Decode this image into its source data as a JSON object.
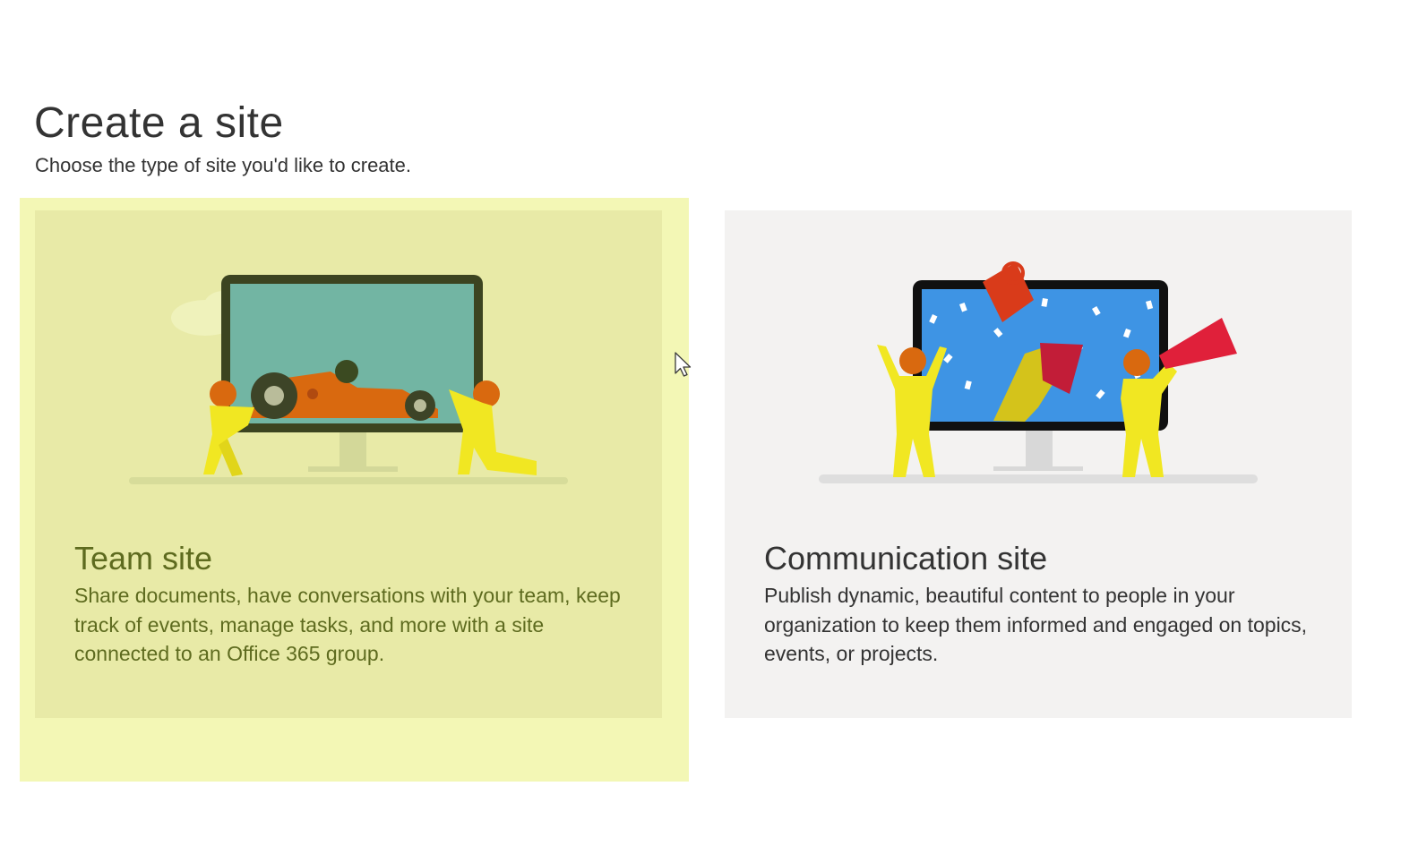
{
  "page": {
    "title": "Create a site",
    "subtitle": "Choose the type of site you'd like to create."
  },
  "cards": [
    {
      "title": "Team site",
      "description": "Share documents, have conversations with your team, keep track of events, manage tasks, and more with a site connected to an Office 365 group.",
      "illustration": "race-car-pit-crew-illustration",
      "state": "hover"
    },
    {
      "title": "Communication site",
      "description": "Publish dynamic, beautiful content to people in your organization to keep them informed and engaged on topics, events, or projects.",
      "illustration": "trophy-megaphone-illustration",
      "state": "default"
    }
  ],
  "colors": {
    "hover_highlight": "#f3f7b5",
    "team_card_bg": "#e8eaa7",
    "team_text": "#5e6b1f",
    "comm_card_bg": "#f3f2f1",
    "comm_text": "#333333"
  },
  "cursor": "arrow-pointer-icon"
}
